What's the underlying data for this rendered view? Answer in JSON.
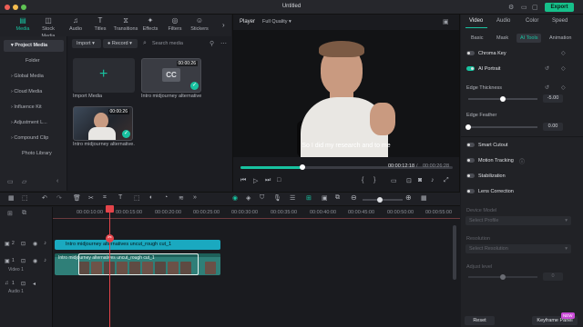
{
  "app": {
    "title": "Untitled",
    "export_label": "Export"
  },
  "top_tools": [
    {
      "label": "Media",
      "icon": "media-icon",
      "active": true
    },
    {
      "label": "Stock Media",
      "icon": "stock-media-icon"
    },
    {
      "label": "Audio",
      "icon": "audio-icon"
    },
    {
      "label": "Titles",
      "icon": "titles-icon"
    },
    {
      "label": "Transitions",
      "icon": "transitions-icon"
    },
    {
      "label": "Effects",
      "icon": "effects-icon"
    },
    {
      "label": "Filters",
      "icon": "filters-icon"
    },
    {
      "label": "Stickers",
      "icon": "stickers-icon"
    }
  ],
  "sidebar": {
    "items": [
      {
        "label": "Project Media"
      },
      {
        "label": "Folder"
      },
      {
        "label": "Global Media"
      },
      {
        "label": "Cloud Media"
      },
      {
        "label": "Influence Kit"
      },
      {
        "label": "Adjustment L..."
      },
      {
        "label": "Compound Clip"
      },
      {
        "label": "Photo Library"
      }
    ]
  },
  "media": {
    "import_label": "Import",
    "record_label": "Record",
    "search_placeholder": "Search media",
    "items": [
      {
        "label": "Import Media"
      },
      {
        "label": "Intro midjourney alternative...",
        "duration": "00:00:26",
        "badge": "CC"
      },
      {
        "label": "Intro midjourney alternative...",
        "duration": "00:00:26"
      }
    ]
  },
  "player": {
    "tab": "Player",
    "quality": "Full Quality",
    "subtitle": "So I did my research and to me",
    "current_time": "00:00:12:18",
    "total_time": "00:00:26:28",
    "progress": 0.29
  },
  "right_panel": {
    "tabs": [
      "Video",
      "Audio",
      "Color",
      "Speed"
    ],
    "subtabs": [
      "Basic",
      "Mask",
      "AI Tools",
      "Animation"
    ],
    "chroma_key": "Chroma Key",
    "ai_portrait": "AI Portrait",
    "edge_thickness": {
      "label": "Edge Thickness",
      "value": "-5.00",
      "level": 0.5
    },
    "edge_feather": {
      "label": "Edge Feather",
      "value": "0.00",
      "level": 0.0
    },
    "toggles": [
      "Smart Cutout",
      "Motion Tracking",
      "Stabilization",
      "Lens Correction"
    ],
    "device_model": {
      "label": "Device Model",
      "placeholder": "Select Profile"
    },
    "resolution": {
      "label": "Resolution",
      "placeholder": "Select Resolution"
    },
    "adjust_level": {
      "label": "Adjust level",
      "value": "0"
    },
    "reset_label": "Reset",
    "keyframe_label": "Keyframe Panel",
    "keyframe_badge": "NEW"
  },
  "timeline": {
    "ticks": [
      "00:00:10:00",
      "00:00:15:00",
      "00:00:20:00",
      "00:00:25:00",
      "00:00:30:00",
      "00:00:35:00",
      "00:00:40:00",
      "00:00:45:00",
      "00:00:50:00",
      "00:00:55:00"
    ],
    "title_clip": "Intro midjourney alternatives uncut_rough cut_1",
    "video_clip": "Intro midjourney alternatives uncut_rough cut_1",
    "track_video_label": "Video 1",
    "track_audio_label": "Audio 1",
    "track_video_num": "2",
    "track_video1_num": "1",
    "track_audio_num": "1"
  },
  "colors": {
    "accent": "#18c2a0",
    "export": "#16c08a",
    "playhead": "#e4444a"
  }
}
